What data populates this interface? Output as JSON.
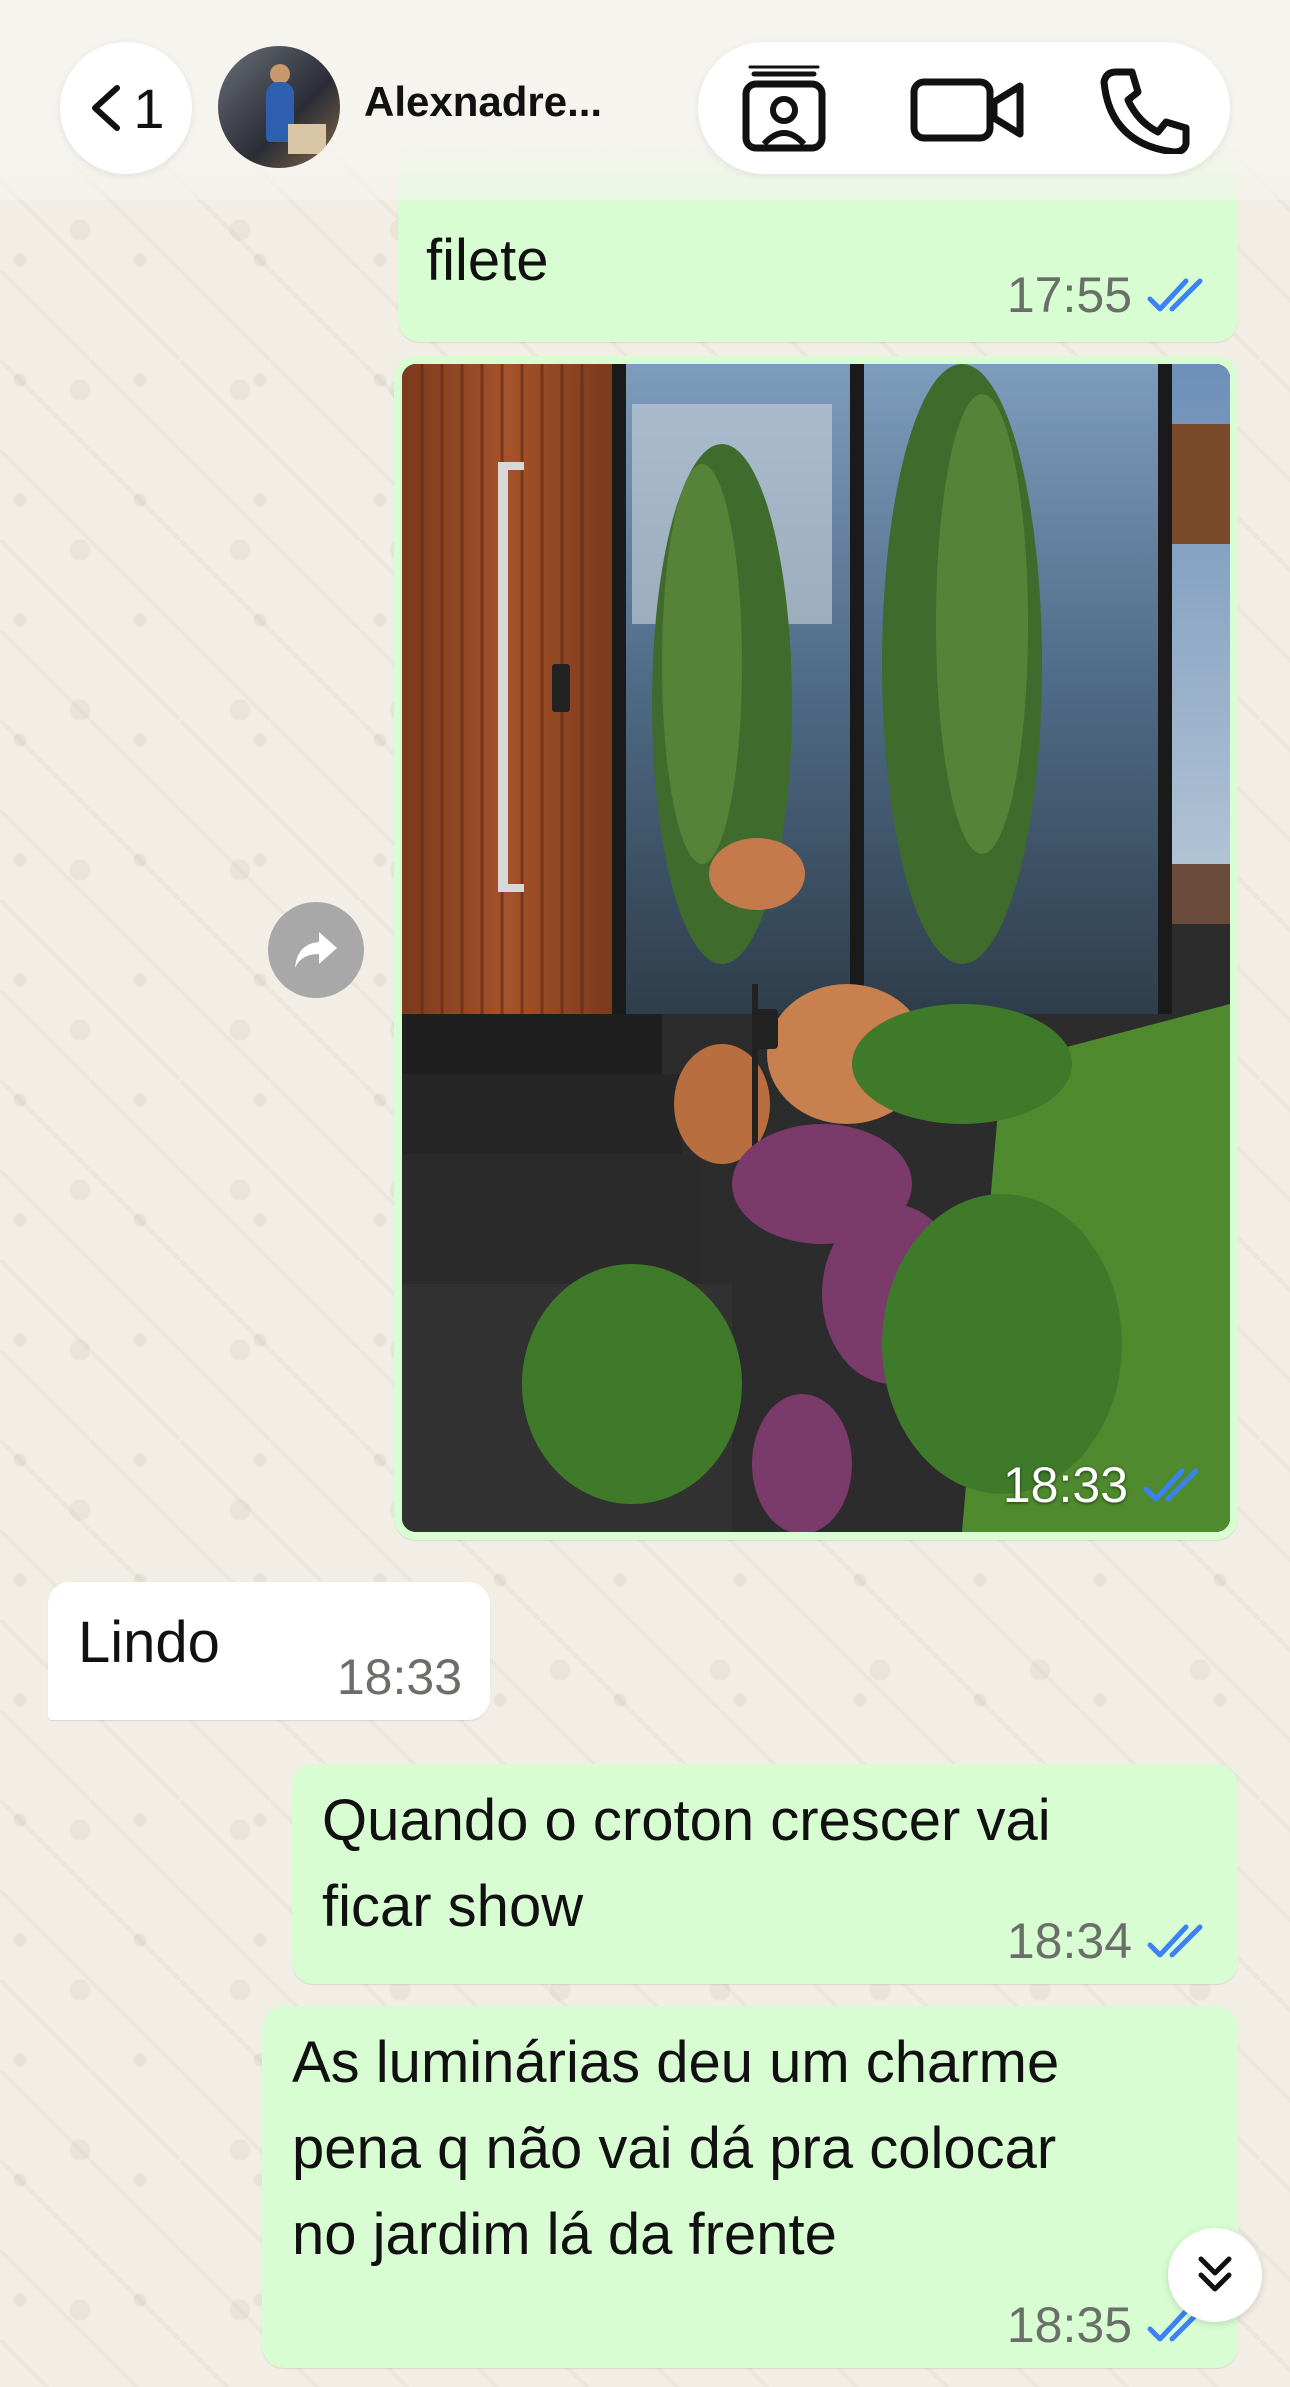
{
  "header": {
    "back_count": "1",
    "contact_name": "Alexnadre...",
    "icons": [
      "chevron-left-icon",
      "contact-card-icon",
      "video-camera-icon",
      "phone-icon"
    ]
  },
  "messages": [
    {
      "id": "m1",
      "direction": "out",
      "text": "filete",
      "time": "17:55",
      "status": "read"
    },
    {
      "id": "m2",
      "direction": "out",
      "type": "image",
      "time": "18:33",
      "status": "read"
    },
    {
      "id": "m3",
      "direction": "in",
      "text": "Lindo",
      "time": "18:33"
    },
    {
      "id": "m4",
      "direction": "out",
      "lines": [
        "Quando o croton crescer vai",
        "ficar show"
      ],
      "time": "18:34",
      "status": "read"
    },
    {
      "id": "m5",
      "direction": "out",
      "lines": [
        "As luminárias deu um charme",
        "pena q não vai dá pra colocar",
        "no jardim lá da frente"
      ],
      "time": "18:35",
      "status": "read"
    }
  ],
  "colors": {
    "outgoing_bubble": "#d9fdd3",
    "incoming_bubble": "#ffffff",
    "read_ticks": "#3b82f6",
    "wallpaper": "#f2eee5"
  }
}
